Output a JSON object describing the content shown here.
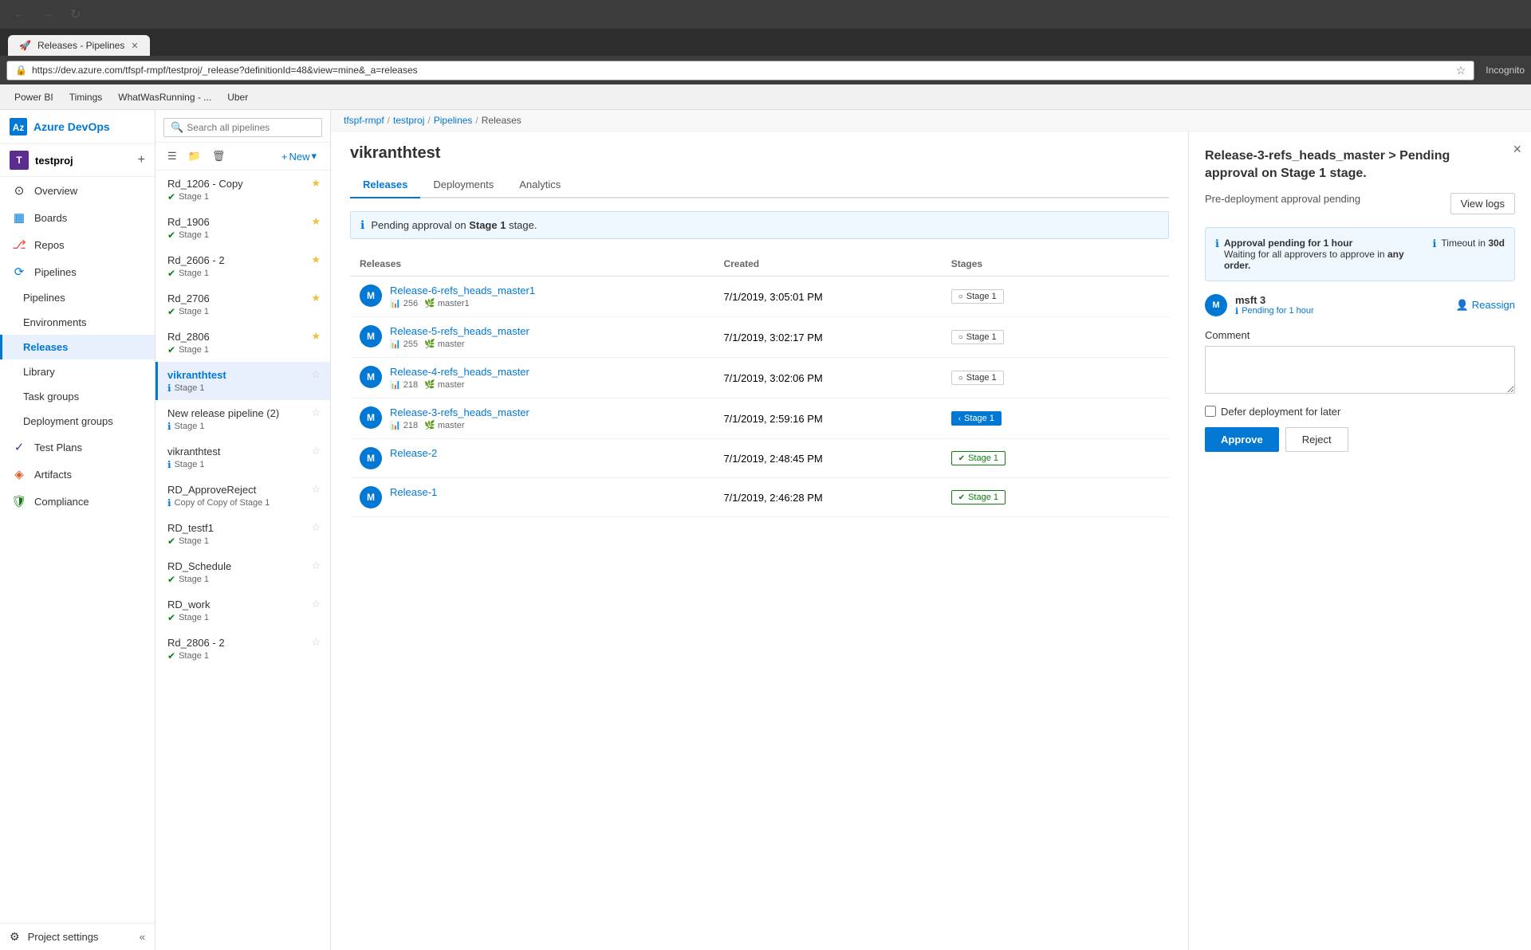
{
  "browser": {
    "tab_title": "Releases - Pipelines",
    "url": "https://dev.azure.com/tfspf-rmpf/testproj/_release?definitionId=48&view=mine&_a=releases",
    "bookmarks": [
      "Power BI",
      "Timings",
      "WhatWasRunning - ...",
      "Uber"
    ],
    "nav_back": "←",
    "nav_forward": "→",
    "nav_refresh": "↻",
    "incognito_label": "Incognito"
  },
  "breadcrumb": {
    "items": [
      "tfspf-rmpf",
      "testproj",
      "Pipelines",
      "Releases"
    ],
    "separators": [
      "/",
      "/",
      "/"
    ]
  },
  "sidebar": {
    "brand": "Azure DevOps",
    "project_initial": "T",
    "project_name": "testproj",
    "add_icon": "+",
    "nav_items": [
      {
        "id": "overview",
        "label": "Overview",
        "icon": "⊙"
      },
      {
        "id": "boards",
        "label": "Boards",
        "icon": "▦"
      },
      {
        "id": "repos",
        "label": "Repos",
        "icon": "⎇"
      },
      {
        "id": "pipelines",
        "label": "Pipelines",
        "icon": "↕"
      },
      {
        "id": "pipelines-sub",
        "label": "Pipelines",
        "icon": "≡",
        "sub": true
      },
      {
        "id": "environments",
        "label": "Environments",
        "icon": "⬡",
        "sub": true
      },
      {
        "id": "releases",
        "label": "Releases",
        "icon": "🚀",
        "sub": true,
        "active": true
      },
      {
        "id": "library",
        "label": "Library",
        "icon": "📚",
        "sub": true
      },
      {
        "id": "task-groups",
        "label": "Task groups",
        "icon": "⊞",
        "sub": true
      },
      {
        "id": "deployment-groups",
        "label": "Deployment groups",
        "icon": "☁",
        "sub": true
      },
      {
        "id": "test-plans",
        "label": "Test Plans",
        "icon": "✓"
      },
      {
        "id": "artifacts",
        "label": "Artifacts",
        "icon": "📦"
      },
      {
        "id": "compliance",
        "label": "Compliance",
        "icon": "🛡"
      }
    ],
    "settings_label": "Project settings"
  },
  "pipeline_list": {
    "search_placeholder": "Search all pipelines",
    "new_label": "New",
    "items": [
      {
        "name": "Rd_1206 - Copy",
        "stage": "Stage 1",
        "stage_type": "green",
        "starred": true
      },
      {
        "name": "Rd_1906",
        "stage": "Stage 1",
        "stage_type": "green",
        "starred": true
      },
      {
        "name": "Rd_2606 - 2",
        "stage": "Stage 1",
        "stage_type": "green",
        "starred": true
      },
      {
        "name": "Rd_2706",
        "stage": "Stage 1",
        "stage_type": "green",
        "starred": true
      },
      {
        "name": "Rd_2806",
        "stage": "Stage 1",
        "stage_type": "green",
        "starred": true
      },
      {
        "name": "vikranthtest",
        "stage": "Stage 1",
        "stage_type": "blue",
        "starred": false,
        "active": true
      },
      {
        "name": "New release pipeline (2)",
        "stage": "Stage 1",
        "stage_type": "blue",
        "starred": false
      },
      {
        "name": "vikranthtest",
        "stage": "Stage 1",
        "stage_type": "blue",
        "starred": false
      },
      {
        "name": "RD_ApproveReject",
        "stage": "Copy of Copy of Stage 1",
        "stage_type": "blue",
        "starred": false
      },
      {
        "name": "RD_testf1",
        "stage": "Stage 1",
        "stage_type": "green",
        "starred": false
      },
      {
        "name": "RD_Schedule",
        "stage": "Stage 1",
        "stage_type": "green",
        "starred": false
      },
      {
        "name": "RD_work",
        "stage": "Stage 1",
        "stage_type": "green",
        "starred": false
      },
      {
        "name": "Rd_2806 - 2",
        "stage": "Stage 1",
        "stage_type": "green",
        "starred": false
      }
    ]
  },
  "releases_panel": {
    "title": "vikranthtest",
    "tabs": [
      "Releases",
      "Deployments",
      "Analytics"
    ],
    "active_tab": "Releases",
    "info_banner": "Pending approval on Stage 1 stage.",
    "table_headers": [
      "Releases",
      "Created",
      "Stages"
    ],
    "releases": [
      {
        "avatar": "M",
        "name": "Release-6-refs_heads_master1",
        "meta_count": "256",
        "meta_branch": "master1",
        "created": "7/1/2019, 3:05:01 PM",
        "stage_label": "Stage 1",
        "stage_type": "default"
      },
      {
        "avatar": "M",
        "name": "Release-5-refs_heads_master",
        "meta_count": "255",
        "meta_branch": "master",
        "created": "7/1/2019, 3:02:17 PM",
        "stage_label": "Stage 1",
        "stage_type": "default"
      },
      {
        "avatar": "M",
        "name": "Release-4-refs_heads_master",
        "meta_count": "218",
        "meta_branch": "master",
        "created": "7/1/2019, 3:02:06 PM",
        "stage_label": "Stage 1",
        "stage_type": "default"
      },
      {
        "avatar": "M",
        "name": "Release-3-refs_heads_master",
        "meta_count": "218",
        "meta_branch": "master",
        "created": "7/1/2019, 2:59:16 PM",
        "stage_label": "Stage 1",
        "stage_type": "blue"
      },
      {
        "avatar": "M",
        "name": "Release-2",
        "meta_count": "",
        "meta_branch": "",
        "created": "7/1/2019, 2:48:45 PM",
        "stage_label": "Stage 1",
        "stage_type": "green"
      },
      {
        "avatar": "M",
        "name": "Release-1",
        "meta_count": "",
        "meta_branch": "",
        "created": "7/1/2019, 2:46:28 PM",
        "stage_label": "Stage 1",
        "stage_type": "green"
      }
    ]
  },
  "approval_panel": {
    "title": "Release-3-refs_heads_master > Pending approval on Stage 1 stage.",
    "subtitle": "Pre-deployment approval pending",
    "view_logs_label": "View logs",
    "info_pending": "Approval pending for 1 hour",
    "info_waiting": "Waiting for all approvers to approve in",
    "info_order": "any order.",
    "timeout_label": "Timeout in",
    "timeout_value": "30d",
    "approver_avatar": "M",
    "approver_name": "msft 3",
    "approver_status": "Pending for 1 hour",
    "reassign_label": "Reassign",
    "comment_label": "Comment",
    "comment_placeholder": "",
    "defer_label": "Defer deployment for later",
    "approve_label": "Approve",
    "reject_label": "Reject",
    "close_icon": "×"
  }
}
